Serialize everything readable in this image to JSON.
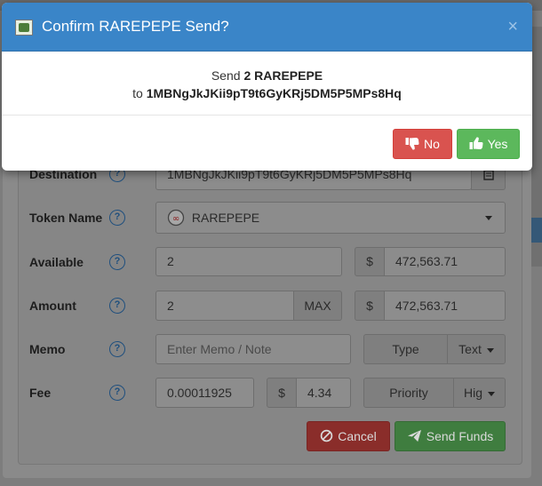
{
  "modal": {
    "title": "Confirm RAREPEPE Send?",
    "close_glyph": "×",
    "body_line1_prefix": "Send",
    "body_line1_amount": "2 RAREPEPE",
    "body_line2_prefix": "to",
    "body_line2_address": "1MBNgJkJKii9pT9t6GyKRj5DM5P5MPs8Hq",
    "no_label": "No",
    "yes_label": "Yes",
    "icons": {
      "logo": "rarepepe-logo-icon",
      "no": "thumbs-down-icon",
      "yes": "thumbs-up-icon"
    },
    "colors": {
      "header": "#3a85c8",
      "no": "#d9534f",
      "yes": "#5cb85c"
    }
  },
  "form": {
    "help_glyph": "?",
    "destination": {
      "label": "Destination",
      "value": "1MBNgJkJKii9pT9t6GyKRj5DM5P5MPs8Hq"
    },
    "token": {
      "label": "Token Name",
      "value": "RAREPEPE"
    },
    "available": {
      "label": "Available",
      "value": "2",
      "currency": "$",
      "usd": "472,563.71"
    },
    "amount": {
      "label": "Amount",
      "value": "2",
      "max_label": "MAX",
      "currency": "$",
      "usd": "472,563.71"
    },
    "memo": {
      "label": "Memo",
      "placeholder": "Enter Memo / Note",
      "type_label": "Type",
      "type_value": "Text"
    },
    "fee": {
      "label": "Fee",
      "value": "0.00011925",
      "currency": "$",
      "usd": "4.34",
      "priority_label": "Priority",
      "priority_value": "Hig"
    },
    "cancel_label": "Cancel",
    "send_label": "Send Funds"
  }
}
